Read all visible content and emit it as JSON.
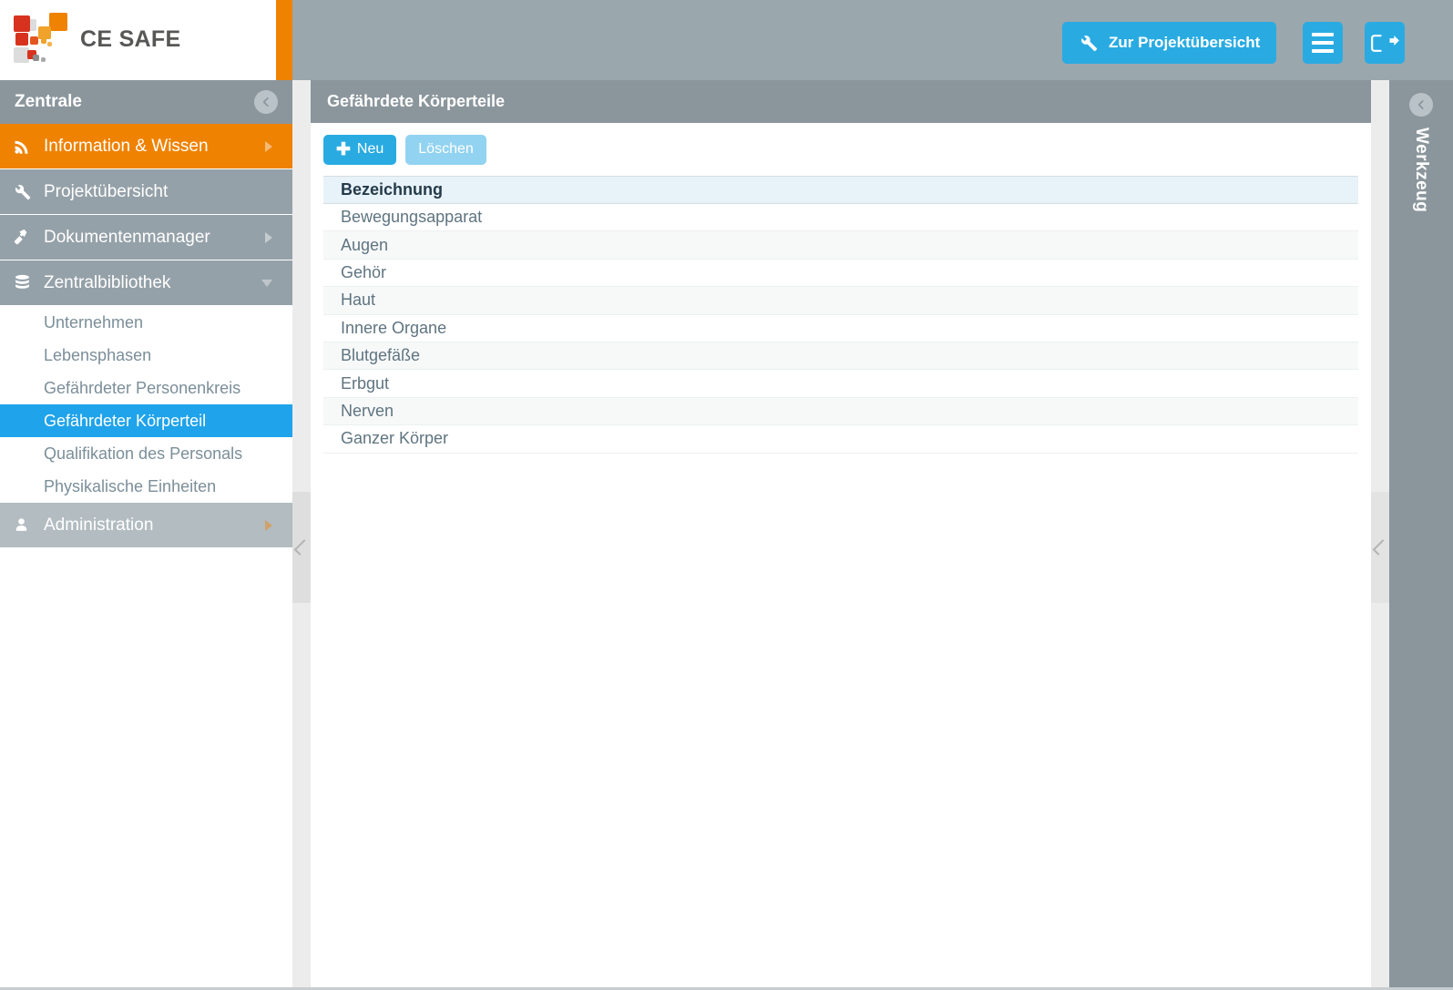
{
  "brand": {
    "name": "CE SAFE",
    "logo_colors": {
      "red": "#d7321e",
      "orange": "#ef8200",
      "gray_dark": "#6f6f6e",
      "gray_light": "#d9d9d9",
      "text": "#575756"
    }
  },
  "theme": {
    "accent_blue": "#29abe2",
    "accent_blue_light": "#92d3f1",
    "accent_orange": "#ef8200",
    "header_gray": "#8b969c",
    "nav_gray": "#95a1a8",
    "nav_gray_muted": "#b2bcc1",
    "selected_blue": "#1fa3ea",
    "grid_header_bg": "#e8f2f9"
  },
  "topbar": {
    "project_overview_label": "Zur Projektübersicht",
    "project_overview_icon": "wrench-icon",
    "menu_icon": "hamburger-menu-icon",
    "logout_icon": "logout-icon"
  },
  "sidebar": {
    "title": "Zentrale",
    "collapse_icon": "chevron-left-circle-icon",
    "items": [
      {
        "label": "Information & Wissen",
        "icon": "rss-signal-icon",
        "state": "active",
        "caret": "right"
      },
      {
        "label": "Projektübersicht",
        "icon": "wrench-icon",
        "state": "normal",
        "caret": "none"
      },
      {
        "label": "Dokumentenmanager",
        "icon": "hammer-icon",
        "state": "normal",
        "caret": "right"
      },
      {
        "label": "Zentralbibliothek",
        "icon": "database-icon",
        "state": "normal",
        "caret": "down"
      }
    ],
    "subitems": [
      {
        "label": "Unternehmen",
        "selected": false
      },
      {
        "label": "Lebensphasen",
        "selected": false
      },
      {
        "label": "Gefährdeter Personenkreis",
        "selected": false
      },
      {
        "label": "Gefährdeter Körperteil",
        "selected": true
      },
      {
        "label": "Qualifikation des Personals",
        "selected": false
      },
      {
        "label": "Physikalische Einheiten",
        "selected": false
      }
    ],
    "footer_item": {
      "label": "Administration",
      "icon": "user-icon",
      "state": "muted",
      "caret": "right"
    },
    "collapse_handle_icon": "chevron-left-icon"
  },
  "main": {
    "title": "Gefährdete Körperteile",
    "toolbar": {
      "new_label": "Neu",
      "new_icon": "plus-icon",
      "delete_label": "Löschen"
    },
    "table": {
      "columns": [
        "Bezeichnung"
      ],
      "rows": [
        "Bewegungsapparat",
        "Augen",
        "Gehör",
        "Haut",
        "Innere Organe",
        "Blutgefäße",
        "Erbgut",
        "Nerven",
        "Ganzer Körper"
      ]
    }
  },
  "tools_panel": {
    "label": "Werkzeug",
    "collapse_icon": "chevron-left-circle-icon",
    "collapse_handle_icon": "chevron-left-icon"
  }
}
